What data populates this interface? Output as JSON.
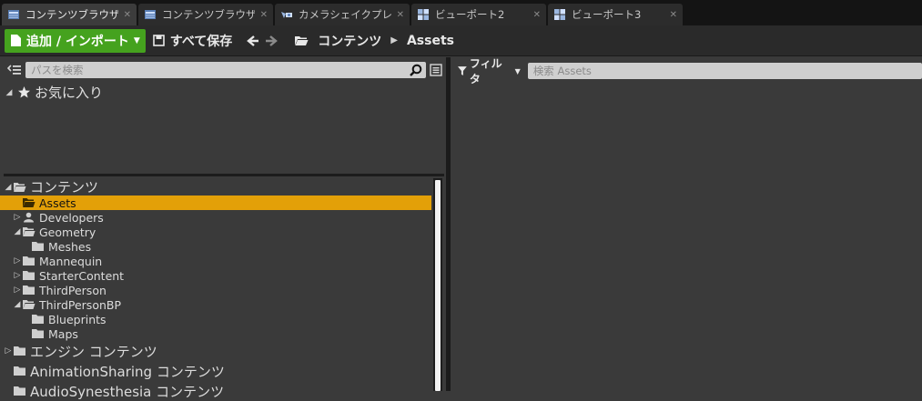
{
  "tabs": [
    {
      "label": "コンテンツブラウザ",
      "icon": "content-browser-icon",
      "active": true
    },
    {
      "label": "コンテンツブラウザ",
      "icon": "content-browser-icon",
      "active": false
    },
    {
      "label": "カメラシェイクプレビ",
      "icon": "camera-shake-icon",
      "active": false
    },
    {
      "label": "ビューポート2",
      "icon": "viewport-icon",
      "active": false
    },
    {
      "label": "ビューポート3",
      "icon": "viewport-icon",
      "active": false
    }
  ],
  "tab_close": "✕",
  "toolbar": {
    "add_import_label": "追加 / インポート",
    "save_all_label": "すべて保存",
    "breadcrumb": [
      "コンテンツ",
      "Assets"
    ]
  },
  "left": {
    "path_search_placeholder": "パスを検索",
    "favorites_label": "お気に入り",
    "tree": [
      {
        "label": "コンテンツ",
        "depth": 0,
        "arrow": "◢",
        "size": "big",
        "icon": "folder-open-icon"
      },
      {
        "label": "Assets",
        "depth": 1,
        "arrow": "",
        "size": "small",
        "icon": "folder-open-icon",
        "selected": true
      },
      {
        "label": "Developers",
        "depth": 1,
        "arrow": "▷",
        "size": "small",
        "icon": "user-icon"
      },
      {
        "label": "Geometry",
        "depth": 1,
        "arrow": "◢",
        "size": "small",
        "icon": "folder-open-icon"
      },
      {
        "label": "Meshes",
        "depth": 2,
        "arrow": "",
        "size": "small",
        "icon": "folder-icon"
      },
      {
        "label": "Mannequin",
        "depth": 1,
        "arrow": "▷",
        "size": "small",
        "icon": "folder-icon"
      },
      {
        "label": "StarterContent",
        "depth": 1,
        "arrow": "▷",
        "size": "small",
        "icon": "folder-icon"
      },
      {
        "label": "ThirdPerson",
        "depth": 1,
        "arrow": "▷",
        "size": "small",
        "icon": "folder-icon"
      },
      {
        "label": "ThirdPersonBP",
        "depth": 1,
        "arrow": "◢",
        "size": "small",
        "icon": "folder-open-icon"
      },
      {
        "label": "Blueprints",
        "depth": 2,
        "arrow": "",
        "size": "small",
        "icon": "folder-icon"
      },
      {
        "label": "Maps",
        "depth": 2,
        "arrow": "",
        "size": "small",
        "icon": "folder-icon"
      },
      {
        "label": "エンジン コンテンツ",
        "depth": 0,
        "arrow": "▷",
        "size": "gap",
        "icon": "folder-icon"
      },
      {
        "label": "AnimationSharing コンテンツ",
        "depth": 0,
        "arrow": "",
        "size": "gap",
        "icon": "folder-icon"
      },
      {
        "label": "AudioSynesthesia コンテンツ",
        "depth": 0,
        "arrow": "",
        "size": "gap",
        "icon": "folder-icon"
      }
    ]
  },
  "right": {
    "filter_label": "フィルタ",
    "asset_search_placeholder": "検索 Assets"
  },
  "colors": {
    "add_button": "#45a21e",
    "selection": "#e3a008",
    "panel_bg": "#3a3a3a",
    "tab_bar_bg": "#141414"
  }
}
